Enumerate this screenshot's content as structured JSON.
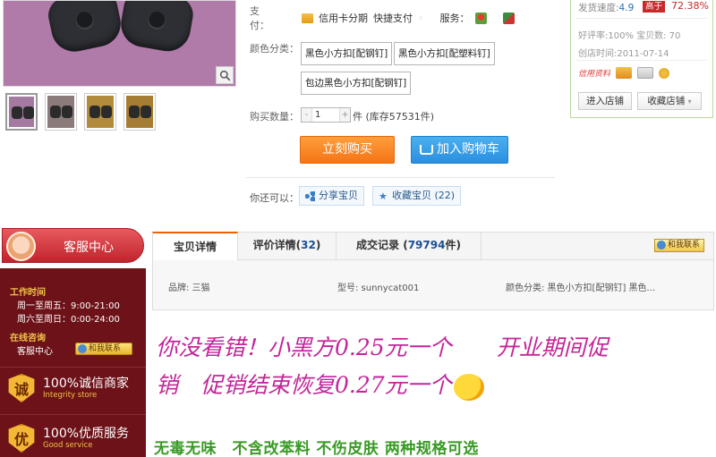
{
  "gallery": {
    "thumbnails": 4
  },
  "purchase": {
    "payment_label": "支　　付：",
    "payment_credit": "信用卡分期",
    "payment_quick": "快捷支付",
    "service_label": "服务：",
    "color_label": "颜色分类：",
    "sku_options": [
      "黑色小方扣[配钢钉]",
      "黑色小方扣[配塑料钉]",
      "包边黑色小方扣[配钢钉]"
    ],
    "qty_label": "购买数量：",
    "qty_value": "1",
    "stock_text": "件 (库存57531件)",
    "buy_now": "立刻购买",
    "add_cart": "加入购物车",
    "share_prompt": "你还可以：",
    "share_btn": "分享宝贝",
    "fav_btn": "收藏宝贝 (22)"
  },
  "shop": {
    "ship_speed_label": "发货速度:",
    "ship_speed_value": "4.9",
    "high_badge": "高于",
    "high_pct": "72.38%",
    "good_rate": "好评率:100%  宝贝数: 70",
    "created": "创店时间:2011-07-14",
    "credit_label": "信用资料",
    "enter_shop": "进入店铺",
    "fav_shop": "收藏店铺"
  },
  "sidebar": {
    "cs_title": "客服中心",
    "work_hours_title": "工作时间",
    "hours_weekday": "周一至周五：9:00-21:00",
    "hours_weekend": "周六至周日：0:00-24:00",
    "online_title": "在线咨询",
    "cs_link": "客服中心",
    "contact_me": "和我联系",
    "badges": [
      {
        "seal": "诚",
        "title": "100%诚信商家",
        "sub": "Integrity store"
      },
      {
        "seal": "优",
        "title": "100%优质服务",
        "sub": "Good service"
      }
    ]
  },
  "tabs": {
    "detail": "宝贝详情",
    "reviews_prefix": "评价详情(",
    "reviews_count": "32",
    "reviews_suffix": ")",
    "records_prefix": "成交记录 (",
    "records_count": "79794",
    "records_suffix": "件)",
    "contact_me": "和我联系"
  },
  "attributes": {
    "brand": "品牌: 三猫",
    "model": "型号: sunnycat001",
    "color": "颜色分类: 黑色小方扣[配钢钉] 黑色..."
  },
  "description": {
    "line1": "你没看错！小黑方0.25元一个　　开业期间促",
    "line2": "销　促销结束恢复0.27元一个",
    "slogan": "无毒无味　不含改苯料  不伤皮肤  两种规格可选"
  }
}
